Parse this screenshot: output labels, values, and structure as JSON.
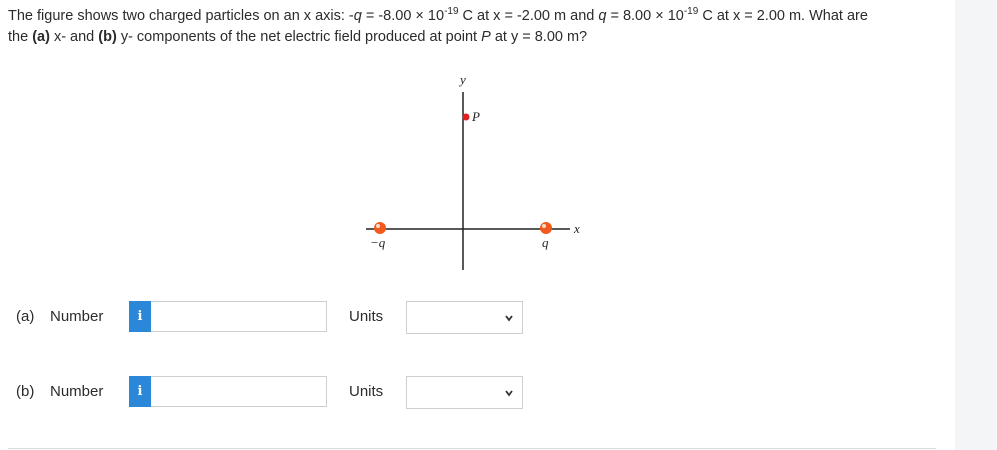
{
  "question": {
    "intro": "The figure shows two charged particles on an x axis: -",
    "q_neg_sym": "q",
    "q_neg_eq": " = -8.00 × 10",
    "q_neg_exp": "-19",
    "q_neg_pos": " C at x = -2.00 m and ",
    "q_pos_sym": "q",
    "q_pos_eq": " = 8.00 × 10",
    "q_pos_exp": "-19",
    "q_pos_pos": " C at x = 2.00 m. What are",
    "line2_start": "the ",
    "part_a_ref": "(a)",
    "mid1": " x- and ",
    "part_b_ref": "(b)",
    "mid2": " y- components of the net electric field produced at point ",
    "point": "P",
    "end": " at y = 8.00 m?"
  },
  "figure": {
    "y_axis_label": "y",
    "x_axis_label": "x",
    "point_label": "P",
    "neg_charge_label": "−q",
    "pos_charge_label": "q",
    "charge_color": "#f25a1d",
    "point_color": "#e02020"
  },
  "answers": [
    {
      "part": "(a)",
      "number_label": "Number",
      "info": "i",
      "value": "",
      "units_label": "Units",
      "units_value": ""
    },
    {
      "part": "(b)",
      "number_label": "Number",
      "info": "i",
      "value": "",
      "units_label": "Units",
      "units_value": ""
    }
  ]
}
